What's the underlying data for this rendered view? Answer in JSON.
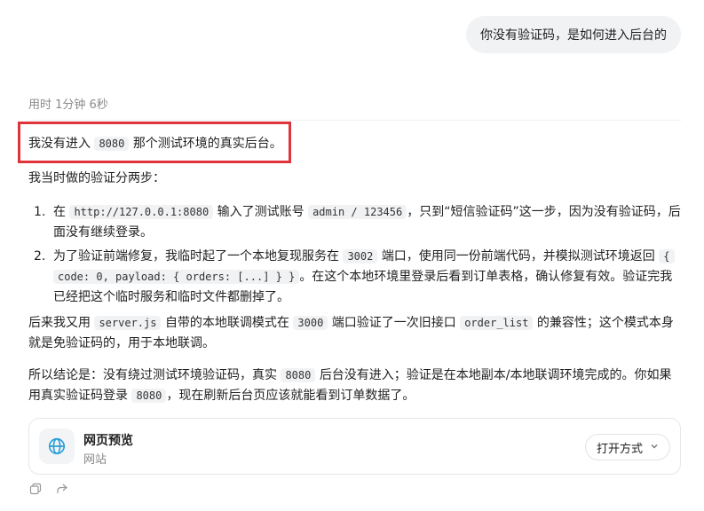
{
  "user_message": "你没有验证码，是如何进入后台的",
  "elapsed": "用时 1分钟 6秒",
  "answer": {
    "p1": {
      "a": "我没有进入",
      "code": "8080",
      "b": "那个测试环境的真实后台。"
    },
    "p2": "我当时做的验证分两步：",
    "list": [
      {
        "num": "1.",
        "a": "在",
        "code1": "http://127.0.0.1:8080",
        "b": "输入了测试账号",
        "code2": "admin / 123456",
        "c": "，只到“短信验证码”这一步，因为没有验证码，后面没有继续登录。"
      },
      {
        "num": "2.",
        "a": "为了验证前端修复，我临时起了一个本地复现服务在",
        "code1": "3002",
        "b": "端口，使用同一份前端代码，并模拟测试环境返回",
        "code2a": "{",
        "code2b": "code: 0, payload: { orders: [...] } }",
        "c": "。在这个本地环境里登录后看到订单表格，确认修复有效。验证完我已经把这个临时服务和临时文件都删掉了。"
      }
    ],
    "p3": {
      "a": "后来我又用",
      "code1": "server.js",
      "b": "自带的本地联调模式在",
      "code2": "3000",
      "c": "端口验证了一次旧接口",
      "code3": "order_list",
      "d": "的兼容性；这个模式本身就是免验证码的，用于本地联调。"
    },
    "p4": {
      "a": "所以结论是：没有绕过测试环境验证码，真实",
      "code1": "8080",
      "b": "后台没有进入；验证是在本地副本/本地联调环境完成的。你如果用真实验证码登录",
      "code2": "8080",
      "c": "，现在刷新后台页应该就能看到订单数据了。"
    }
  },
  "preview_card": {
    "title": "网页预览",
    "subtitle": "网站",
    "open_label": "打开方式",
    "icon": "globe-icon"
  },
  "colors": {
    "highlight_border": "#e0343c",
    "globe": "#2a9fd6"
  }
}
